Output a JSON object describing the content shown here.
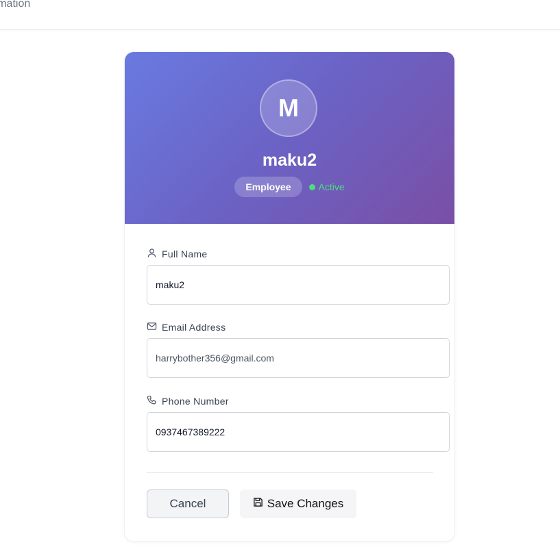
{
  "topbar": {
    "title": "ormation"
  },
  "profile": {
    "avatar_initial": "M",
    "username": "maku2",
    "role": "Employee",
    "status": "Active"
  },
  "form": {
    "full_name": {
      "label": "Full Name",
      "value": "maku2",
      "icon": "user-icon"
    },
    "email": {
      "label": "Email Address",
      "value": "harrybother356@gmail.com",
      "icon": "mail-icon"
    },
    "phone": {
      "label": "Phone Number",
      "value": "0937467389222",
      "icon": "phone-icon"
    }
  },
  "actions": {
    "cancel_label": "Cancel",
    "save_label": "Save Changes",
    "save_icon": "save-icon"
  },
  "colors": {
    "header_gradient_start": "#6a7ae0",
    "header_gradient_end": "#7a4fa6",
    "status_active": "#4ade80"
  }
}
